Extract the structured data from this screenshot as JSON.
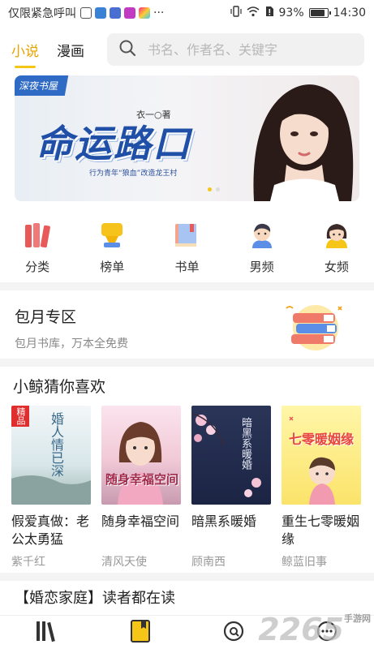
{
  "status_bar": {
    "left_text": "仅限紧急呼叫",
    "battery": "93%",
    "battery_level": 0.93,
    "time": "14:30"
  },
  "top_tabs": [
    {
      "label": "小说",
      "active": true
    },
    {
      "label": "漫画",
      "active": false
    }
  ],
  "search": {
    "placeholder": "书名、作者名、关键字"
  },
  "banner": {
    "ribbon": "深夜书屋",
    "author": "衣一○著",
    "title": "命运路口",
    "subtitle": "行为青年“狼血”改造龙王村",
    "dots": 2,
    "active_dot": 0
  },
  "categories": [
    {
      "label": "分类",
      "icon": "books-stack-icon"
    },
    {
      "label": "榜单",
      "icon": "trophy-icon"
    },
    {
      "label": "书单",
      "icon": "booklist-icon"
    },
    {
      "label": "男频",
      "icon": "boy-icon"
    },
    {
      "label": "女频",
      "icon": "girl-icon"
    }
  ],
  "monthly": {
    "title": "包月专区",
    "subtitle": "包月书库，万本全免费"
  },
  "recommend": {
    "title": "小鲸猜你喜欢",
    "books": [
      {
        "name": "假爱真做：老公太勇猛",
        "author": "紫千红",
        "badge": "精品",
        "cover_text": "婚人情已深"
      },
      {
        "name": "随身幸福空间",
        "author": "清风天使",
        "badge": "",
        "cover_text": "随身幸福空间"
      },
      {
        "name": "暗黑系暖婚",
        "author": "顾南西",
        "badge": "",
        "cover_text": "暗黑系暖婚"
      },
      {
        "name": "重生七零暖姻缘",
        "author": "鲸蓝旧事",
        "badge": "",
        "cover_text": "七零暖姻缘"
      }
    ]
  },
  "section2": {
    "title": "【婚恋家庭】读者都在读"
  },
  "bottom_nav": [
    {
      "icon": "bookshelf-icon"
    },
    {
      "icon": "bookstore-icon"
    },
    {
      "icon": "discover-icon"
    },
    {
      "icon": "more-icon"
    }
  ],
  "watermark": {
    "number": "2265",
    "suffix": "手游网"
  },
  "colors": {
    "accent": "#f5c518",
    "accent_text": "#e6a400",
    "divider": "#f4f4f4"
  }
}
